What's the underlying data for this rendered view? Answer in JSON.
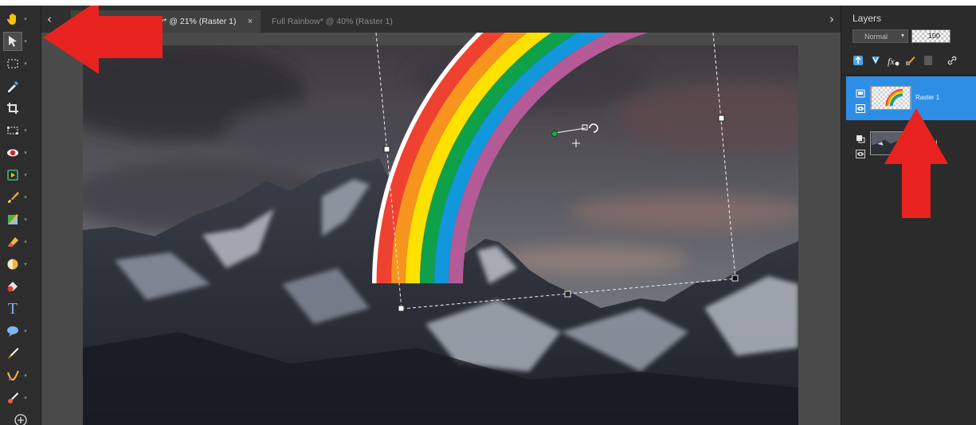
{
  "tabs": [
    {
      "label": "Mountain with Dark Sky* @  21% (Raster 1)",
      "active": true
    },
    {
      "label": "Full Rainbow* @  40% (Raster 1)",
      "active": false
    }
  ],
  "tab_close_glyph": "×",
  "tab_nav": {
    "prev": "‹",
    "next": "›"
  },
  "toolbar": {
    "tools": [
      {
        "name": "pan-tool-icon",
        "dropdown": true
      },
      {
        "name": "pick-tool-icon",
        "dropdown": true,
        "active": true
      },
      {
        "name": "selection-tool-icon",
        "dropdown": true
      },
      {
        "name": "dropper-tool-icon",
        "dropdown": false
      },
      {
        "name": "crop-tool-icon",
        "dropdown": false
      },
      {
        "name": "straighten-tool-icon",
        "dropdown": true
      },
      {
        "name": "red-eye-tool-icon",
        "dropdown": true
      },
      {
        "name": "clone-brush-tool-icon",
        "dropdown": true
      },
      {
        "name": "paint-brush-tool-icon",
        "dropdown": true
      },
      {
        "name": "color-replacer-tool-icon",
        "dropdown": true
      },
      {
        "name": "eraser-tool-icon",
        "dropdown": true
      },
      {
        "name": "dodge-tool-icon",
        "dropdown": true
      },
      {
        "name": "flood-fill-tool-icon",
        "dropdown": false
      },
      {
        "name": "text-tool-icon",
        "dropdown": false
      },
      {
        "name": "preset-shape-tool-icon",
        "dropdown": true
      },
      {
        "name": "pen-tool-icon",
        "dropdown": false
      },
      {
        "name": "warp-brush-tool-icon",
        "dropdown": true
      },
      {
        "name": "picture-tube-tool-icon",
        "dropdown": true
      },
      {
        "name": "add-tool-icon",
        "dropdown": false
      }
    ],
    "text_tool_glyph": "T"
  },
  "layers": {
    "title": "Layers",
    "blend_mode": "Normal",
    "opacity": "100",
    "tool_icons": [
      "new-raster-layer-icon",
      "new-vector-layer-icon",
      "adjustment-layer-icon",
      "mask-icon",
      "delete-layer-icon",
      "link-icon"
    ],
    "items": [
      {
        "name": "Raster 1",
        "selected": true
      },
      {
        "name": "Background",
        "selected": false
      }
    ],
    "background_visible_label": "d"
  },
  "colors": {
    "accent": "#2e8ee6",
    "red_arrow": "#e8231f",
    "rainbow": [
      "#ffffff",
      "#ef4130",
      "#f7941d",
      "#ffe100",
      "#0fa04a",
      "#1296dc",
      "#b35a97"
    ]
  }
}
